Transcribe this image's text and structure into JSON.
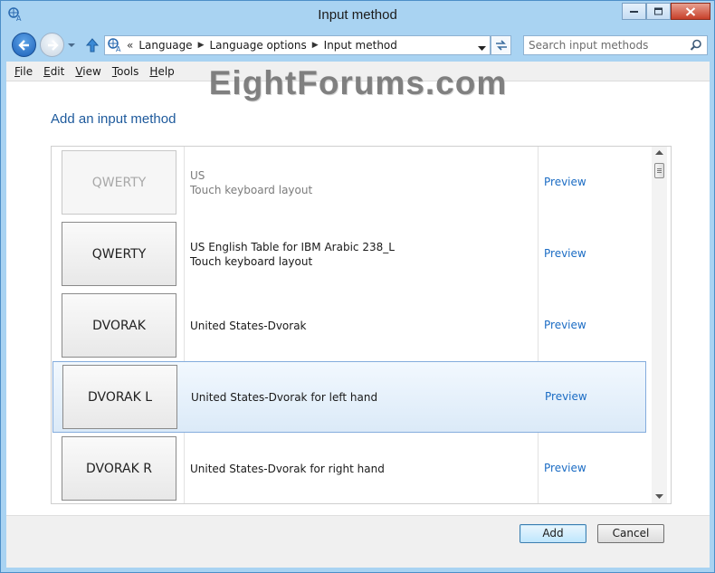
{
  "window": {
    "title": "Input method",
    "app_icon": "language-icon"
  },
  "navigation": {
    "breadcrumb": [
      "Language",
      "Language options",
      "Input method"
    ],
    "first_separator": "«",
    "separator": "▶",
    "search_placeholder": "Search input methods"
  },
  "menu": {
    "items": [
      "File",
      "Edit",
      "View",
      "Tools",
      "Help"
    ]
  },
  "watermark": "EightForums.com",
  "page": {
    "heading": "Add an input method"
  },
  "input_methods": [
    {
      "layout": "QWERTY",
      "line1": "US",
      "line2": "Touch keyboard layout",
      "preview": "Preview",
      "faded": true,
      "selected": false
    },
    {
      "layout": "QWERTY",
      "line1": "US English Table for IBM Arabic 238_L",
      "line2": "Touch keyboard layout",
      "preview": "Preview",
      "faded": false,
      "selected": false
    },
    {
      "layout": "DVORAK",
      "line1": "United States-Dvorak",
      "line2": "",
      "preview": "Preview",
      "faded": false,
      "selected": false
    },
    {
      "layout": "DVORAK L",
      "line1": "United States-Dvorak for left hand",
      "line2": "",
      "preview": "Preview",
      "faded": false,
      "selected": true
    },
    {
      "layout": "DVORAK R",
      "line1": "United States-Dvorak for right hand",
      "line2": "",
      "preview": "Preview",
      "faded": false,
      "selected": false
    }
  ],
  "footer": {
    "add_label": "Add",
    "cancel_label": "Cancel"
  },
  "colors": {
    "accent": "#1e5a9c",
    "link": "#1b6cc4",
    "selection": "#dbeaf8"
  }
}
